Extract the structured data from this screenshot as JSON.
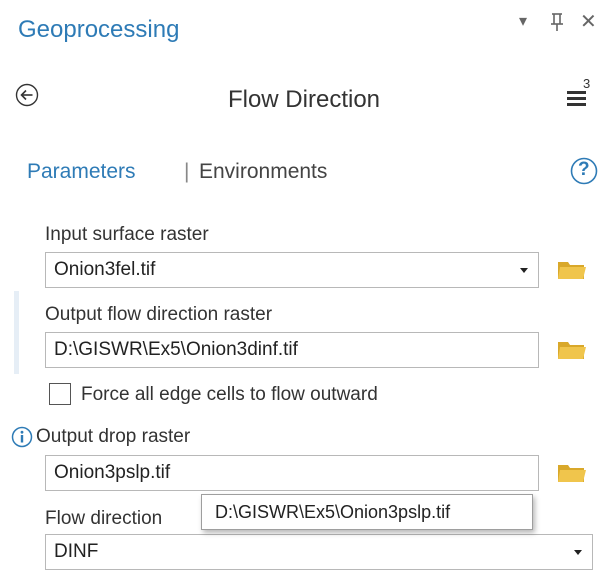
{
  "header": {
    "title": "Geoprocessing",
    "dropdown_glyph": "▾",
    "pin_glyph": "Θ",
    "close_glyph": "✕"
  },
  "tool": {
    "name": "Flow Direction",
    "back_icon": "back-arrow-icon",
    "menu_badge": "3"
  },
  "tabs": {
    "parameters": "Parameters",
    "separator": "|",
    "environments": "Environments",
    "help_glyph": "?"
  },
  "params": {
    "input_surface": {
      "label": "Input surface raster",
      "value": "Onion3fel.tif"
    },
    "output_flow_dir": {
      "label": "Output flow direction raster",
      "value": "D:\\GISWR\\Ex5\\Onion3dinf.tif"
    },
    "force_edge": {
      "label": "Force all edge cells to flow outward",
      "checked": false
    },
    "output_drop": {
      "label": "Output drop raster",
      "value": "Onion3pslp.tif"
    },
    "flow_type": {
      "label": "Flow direction",
      "value": "DINF"
    }
  },
  "tooltip": {
    "text": "D:\\GISWR\\Ex5\\Onion3pslp.tif"
  },
  "colors": {
    "accent": "#2e7bb6",
    "folder": "#e9b93a",
    "selection_bar": "#e6eef6"
  }
}
